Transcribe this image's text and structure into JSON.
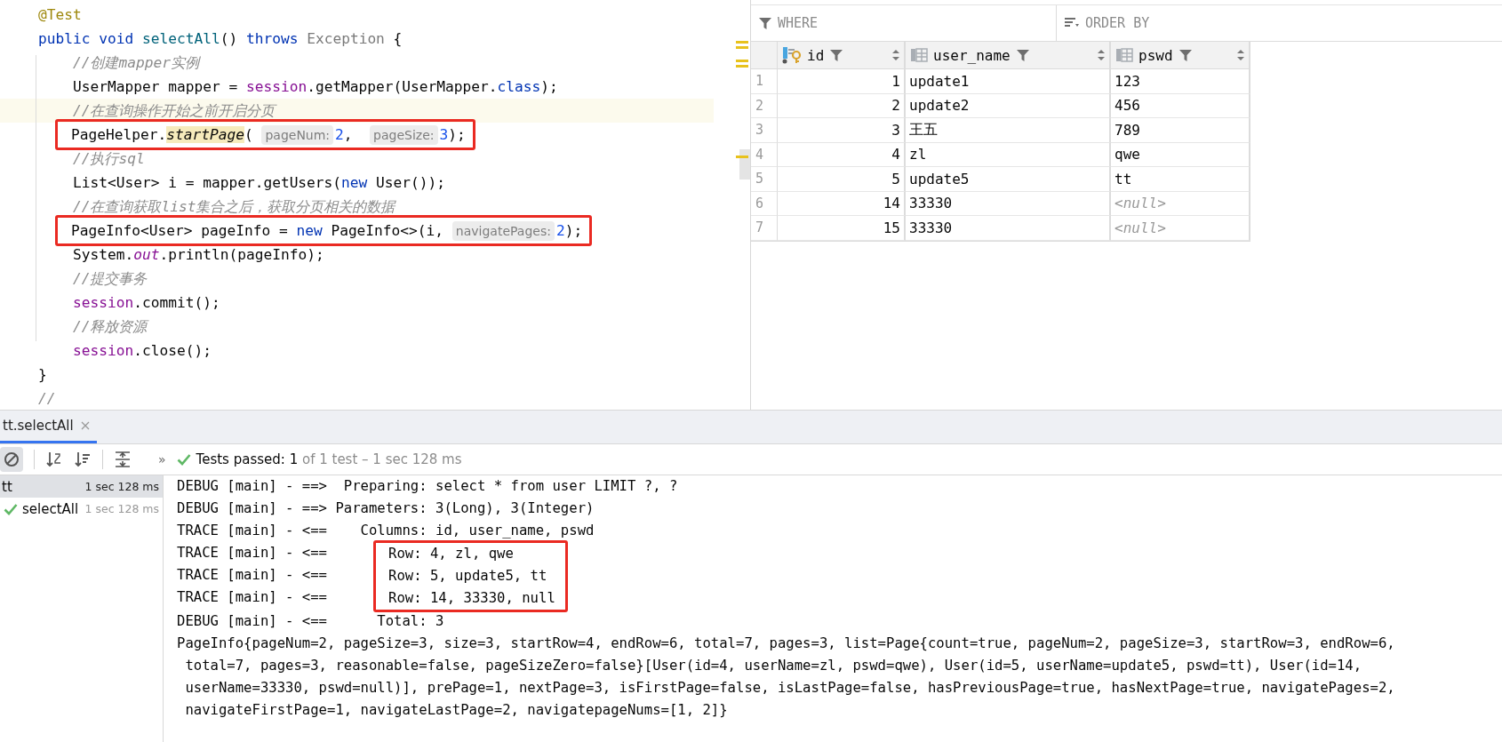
{
  "editor": {
    "lines": [
      {
        "current": false,
        "boxed": false,
        "tokens": [
          {
            "kind": "annot",
            "text": "@Test"
          }
        ]
      },
      {
        "current": false,
        "boxed": false,
        "tokens": [
          {
            "kind": "kw",
            "text": "public void "
          },
          {
            "kind": "decl",
            "text": "selectAll"
          },
          {
            "kind": "plain",
            "text": "() "
          },
          {
            "kind": "kw",
            "text": "throws "
          },
          {
            "kind": "dim",
            "text": "Exception"
          },
          {
            "kind": "plain",
            "text": " {"
          }
        ]
      },
      {
        "current": false,
        "boxed": false,
        "tokens": [
          {
            "kind": "comment",
            "text": "    //创建mapper实例"
          }
        ]
      },
      {
        "current": false,
        "boxed": false,
        "tokens": [
          {
            "kind": "plain",
            "text": "    UserMapper mapper = "
          },
          {
            "kind": "field",
            "text": "session"
          },
          {
            "kind": "plain",
            "text": ".getMapper(UserMapper."
          },
          {
            "kind": "kw",
            "text": "class"
          },
          {
            "kind": "plain",
            "text": ");"
          }
        ]
      },
      {
        "current": true,
        "boxed": false,
        "tokens": [
          {
            "kind": "comment",
            "text": "    //在查询操作开始之前开启分页"
          }
        ]
      },
      {
        "current": false,
        "boxed": true,
        "tokens": [
          {
            "kind": "plain",
            "text": "PageHelper."
          },
          {
            "kind": "usage",
            "text": "startPage"
          },
          {
            "kind": "plain",
            "text": "( "
          },
          {
            "kind": "hint",
            "text": "pageNum:"
          },
          {
            "kind": "num",
            "text": "2"
          },
          {
            "kind": "plain",
            "text": ",  "
          },
          {
            "kind": "hint",
            "text": "pageSize:"
          },
          {
            "kind": "num",
            "text": "3"
          },
          {
            "kind": "plain",
            "text": ");"
          }
        ]
      },
      {
        "current": false,
        "boxed": false,
        "tokens": [
          {
            "kind": "comment",
            "text": "    //执行sql"
          }
        ]
      },
      {
        "current": false,
        "boxed": false,
        "tokens": [
          {
            "kind": "plain",
            "text": "    List<User> i = mapper.getUsers("
          },
          {
            "kind": "kw",
            "text": "new"
          },
          {
            "kind": "plain",
            "text": " User());"
          }
        ]
      },
      {
        "current": false,
        "boxed": false,
        "tokens": [
          {
            "kind": "comment",
            "text": "    //在查询获取list集合之后，获取分页相关的数据"
          }
        ]
      },
      {
        "current": false,
        "boxed": true,
        "tokens": [
          {
            "kind": "plain",
            "text": "PageInfo<User> pageInfo = "
          },
          {
            "kind": "kw",
            "text": "new"
          },
          {
            "kind": "plain",
            "text": " PageInfo<>(i, "
          },
          {
            "kind": "hint",
            "text": "navigatePages:"
          },
          {
            "kind": "num",
            "text": "2"
          },
          {
            "kind": "plain",
            "text": ");"
          }
        ]
      },
      {
        "current": false,
        "boxed": false,
        "tokens": [
          {
            "kind": "plain",
            "text": "    System."
          },
          {
            "kind": "static",
            "text": "out"
          },
          {
            "kind": "plain",
            "text": ".println(pageInfo);"
          }
        ]
      },
      {
        "current": false,
        "boxed": false,
        "tokens": [
          {
            "kind": "comment",
            "text": "    //提交事务"
          }
        ]
      },
      {
        "current": false,
        "boxed": false,
        "tokens": [
          {
            "kind": "field",
            "text": "    session"
          },
          {
            "kind": "plain",
            "text": ".commit();"
          }
        ]
      },
      {
        "current": false,
        "boxed": false,
        "tokens": [
          {
            "kind": "comment",
            "text": "    //释放资源"
          }
        ]
      },
      {
        "current": false,
        "boxed": false,
        "tokens": [
          {
            "kind": "field",
            "text": "    session"
          },
          {
            "kind": "plain",
            "text": ".close();"
          }
        ]
      },
      {
        "current": false,
        "boxed": false,
        "tokens": [
          {
            "kind": "plain",
            "text": "}"
          }
        ]
      },
      {
        "current": false,
        "boxed": false,
        "tokens": [
          {
            "kind": "comment",
            "text": "//"
          }
        ]
      }
    ]
  },
  "table": {
    "where_label": "WHERE",
    "order_label": "ORDER BY",
    "columns": [
      {
        "name": "id",
        "kind": "key"
      },
      {
        "name": "user_name",
        "kind": "column"
      },
      {
        "name": "pswd",
        "kind": "column"
      }
    ],
    "rows": [
      {
        "num": "1",
        "cells": [
          {
            "text": "1",
            "null": false
          },
          {
            "text": "update1",
            "null": false
          },
          {
            "text": "123",
            "null": false
          }
        ]
      },
      {
        "num": "2",
        "cells": [
          {
            "text": "2",
            "null": false
          },
          {
            "text": "update2",
            "null": false
          },
          {
            "text": "456",
            "null": false
          }
        ]
      },
      {
        "num": "3",
        "cells": [
          {
            "text": "3",
            "null": false
          },
          {
            "text": "王五",
            "null": false
          },
          {
            "text": "789",
            "null": false
          }
        ]
      },
      {
        "num": "4",
        "cells": [
          {
            "text": "4",
            "null": false
          },
          {
            "text": "zl",
            "null": false
          },
          {
            "text": "qwe",
            "null": false
          }
        ]
      },
      {
        "num": "5",
        "cells": [
          {
            "text": "5",
            "null": false
          },
          {
            "text": "update5",
            "null": false
          },
          {
            "text": "tt",
            "null": false
          }
        ]
      },
      {
        "num": "6",
        "cells": [
          {
            "text": "14",
            "null": false
          },
          {
            "text": "33330",
            "null": false
          },
          {
            "text": "<null>",
            "null": true
          }
        ]
      },
      {
        "num": "7",
        "cells": [
          {
            "text": "15",
            "null": false
          },
          {
            "text": "33330",
            "null": false
          },
          {
            "text": "<null>",
            "null": true
          }
        ]
      }
    ]
  },
  "run": {
    "tabs": [
      {
        "title": "tt.selectAll",
        "selected": true
      }
    ],
    "more": "»",
    "status": {
      "label": "Tests passed:",
      "count": "1",
      "detail": "of 1 test – 1 sec 128 ms"
    },
    "tree": [
      {
        "name": "tt",
        "time": "1 sec 128 ms",
        "selected": true,
        "passed": false,
        "children": [
          {
            "name": "selectAll",
            "time": "1 sec 128 ms",
            "selected": false,
            "passed": true
          }
        ]
      }
    ],
    "console": [
      {
        "kind": "line",
        "text": "DEBUG [main] - ==>  Preparing: select * from user LIMIT ?, ?"
      },
      {
        "kind": "line",
        "text": "DEBUG [main] - ==> Parameters: 3(Long), 3(Integer)"
      },
      {
        "kind": "line",
        "text": "TRACE [main] - <==    Columns: id, user_name, pswd"
      },
      {
        "kind": "group",
        "rows": [
          {
            "prefix": "TRACE [main] - <==",
            "text": "Row: 4, zl, qwe"
          },
          {
            "prefix": "TRACE [main] - <==",
            "text": "Row: 5, update5, tt"
          },
          {
            "prefix": "TRACE [main] - <==",
            "text": "Row: 14, 33330, null"
          }
        ]
      },
      {
        "kind": "line",
        "text": "DEBUG [main] - <==      Total: 3"
      },
      {
        "kind": "line",
        "text": "PageInfo{pageNum=2, pageSize=3, size=3, startRow=4, endRow=6, total=7, pages=3, list=Page{count=true, pageNum=2, pageSize=3, startRow=3, endRow=6,"
      },
      {
        "kind": "line",
        "text": " total=7, pages=3, reasonable=false, pageSizeZero=false}[User(id=4, userName=zl, pswd=qwe), User(id=5, userName=update5, pswd=tt), User(id=14,"
      },
      {
        "kind": "line",
        "text": " userName=33330, pswd=null)], prePage=1, nextPage=3, isFirstPage=false, isLastPage=false, hasPreviousPage=true, hasNextPage=true, navigatePages=2,"
      },
      {
        "kind": "line",
        "text": " navigateFirstPage=1, navigateLastPage=2, navigatepageNums=[1, 2]}"
      }
    ]
  }
}
